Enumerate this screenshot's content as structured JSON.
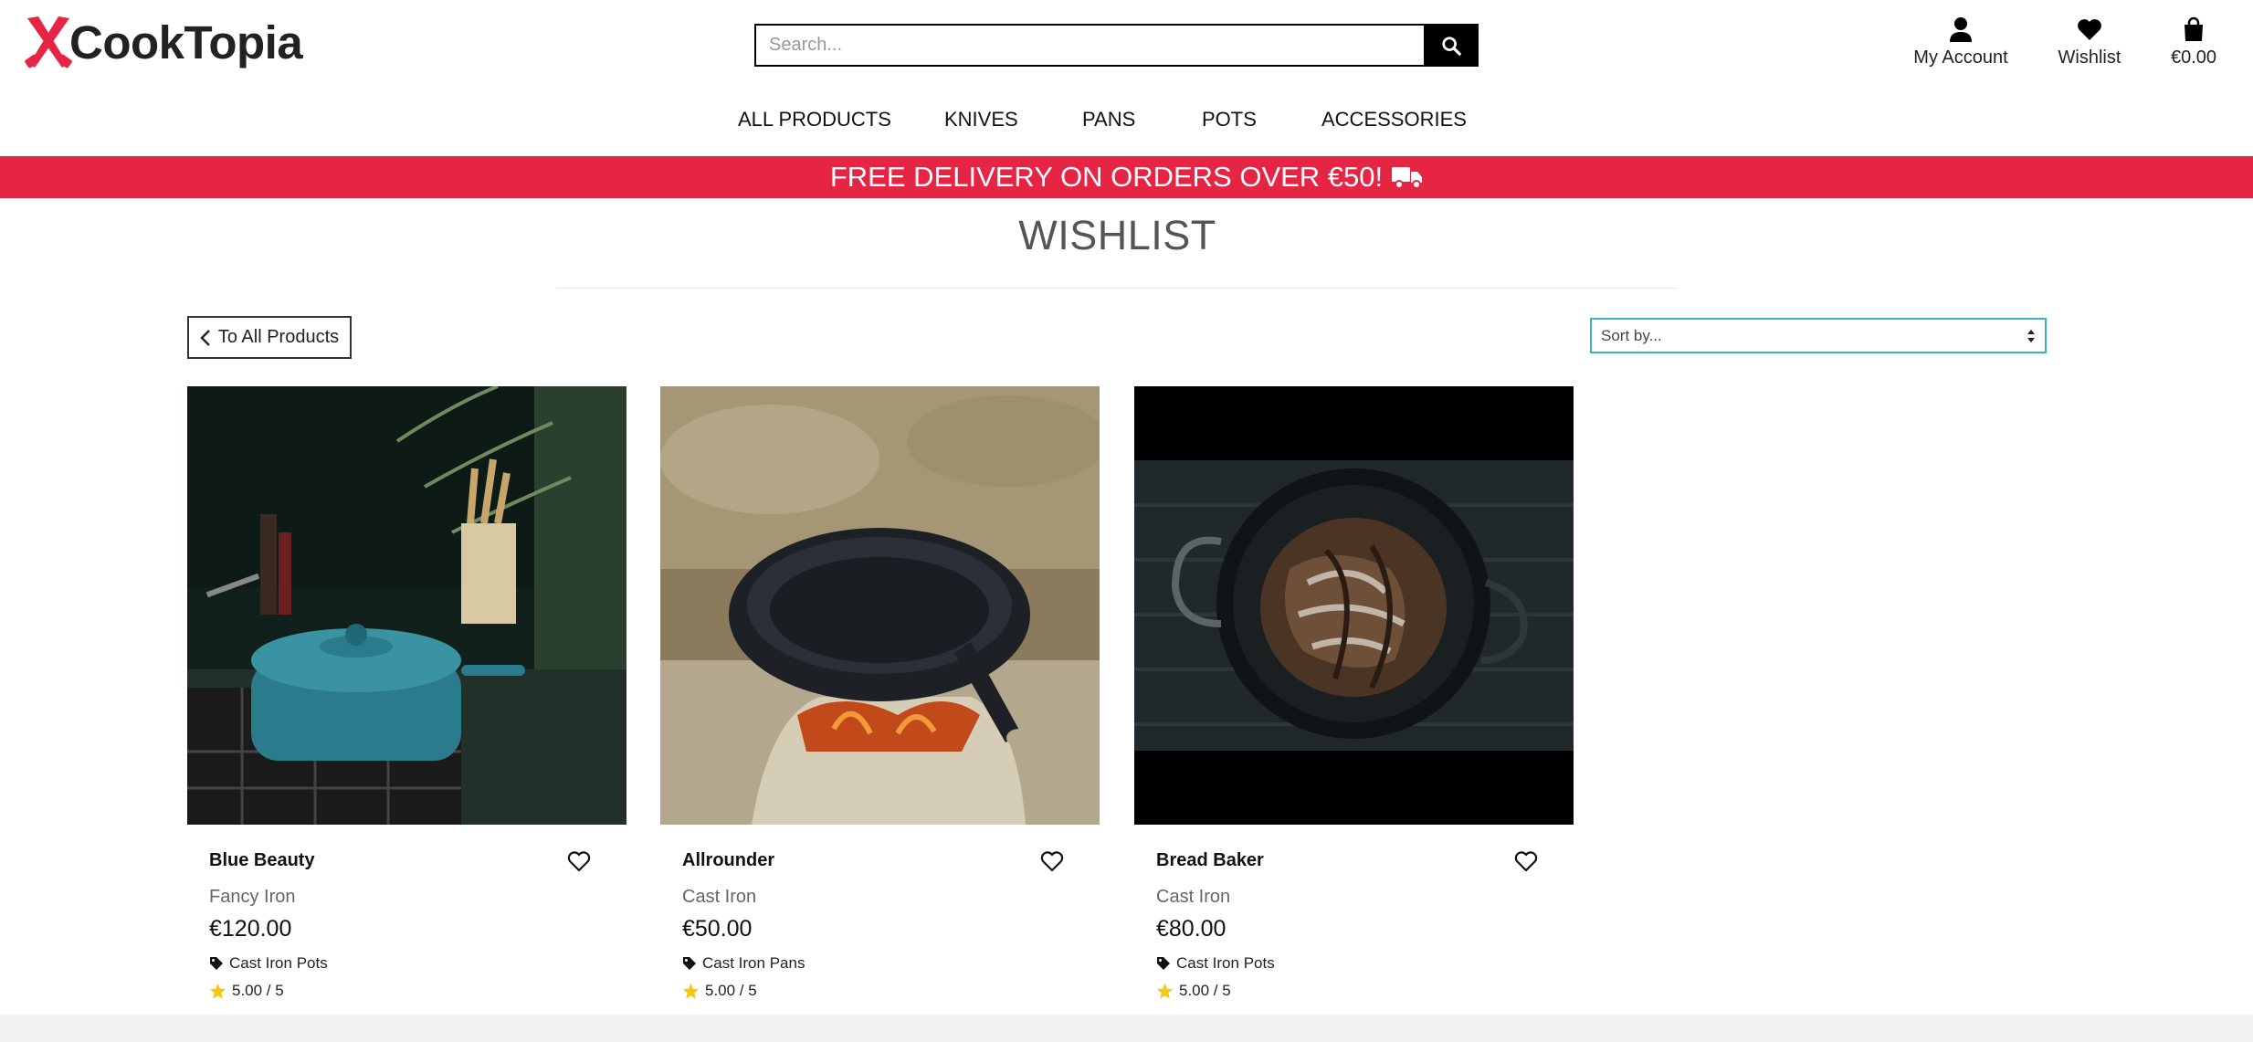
{
  "brand": {
    "name": "CookTopia",
    "logo_icon": "crossed-knives-icon",
    "color": "#e62545"
  },
  "search": {
    "placeholder": "Search...",
    "icon": "search-icon"
  },
  "header_links": {
    "account": "My Account",
    "wishlist": "Wishlist",
    "bag_total": "€0.00"
  },
  "nav": {
    "items": [
      "ALL PRODUCTS",
      "KNIVES",
      "PANS",
      "POTS",
      "ACCESSORIES"
    ]
  },
  "banner": {
    "text": "FREE DELIVERY ON ORDERS OVER €50!",
    "icon": "truck-icon",
    "background": "#e62545"
  },
  "page": {
    "title": "WISHLIST",
    "back_label": "To All Products",
    "sort_placeholder": "Sort by..."
  },
  "products": [
    {
      "name": "Blue Beauty",
      "brand": "Fancy Iron",
      "price": "€120.00",
      "category": "Cast Iron Pots",
      "rating": "5.00 / 5"
    },
    {
      "name": "Allrounder",
      "brand": "Cast Iron",
      "price": "€50.00",
      "category": "Cast Iron Pans",
      "rating": "5.00 / 5"
    },
    {
      "name": "Bread Baker",
      "brand": "Cast Iron",
      "price": "€80.00",
      "category": "Cast Iron Pots",
      "rating": "5.00 / 5"
    }
  ],
  "colors": {
    "sort_border": "#3bb2c8",
    "star": "#f5c518",
    "footer": "#f1f1f1"
  }
}
